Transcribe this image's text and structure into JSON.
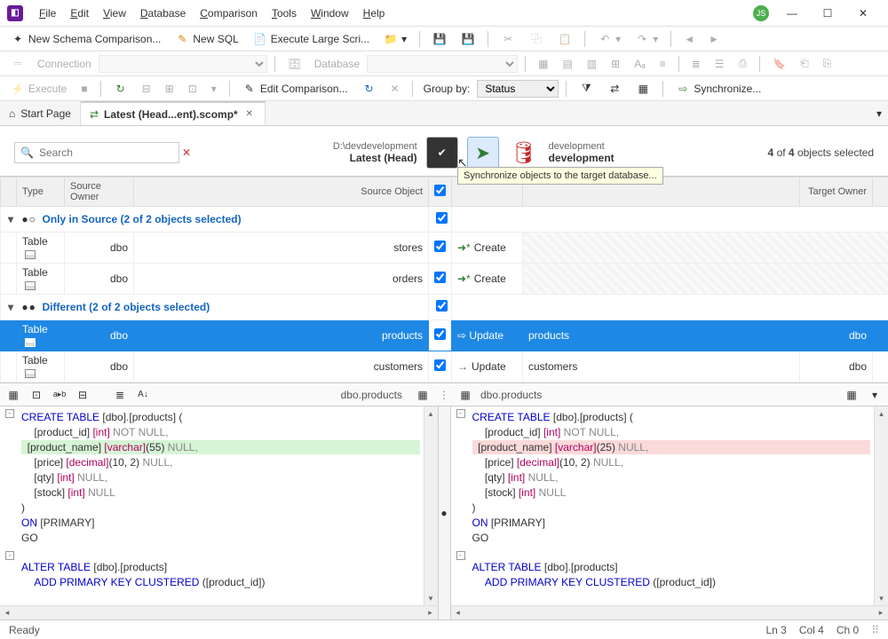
{
  "menu": [
    "File",
    "Edit",
    "View",
    "Database",
    "Comparison",
    "Tools",
    "Window",
    "Help"
  ],
  "user_initials": "JS",
  "toolbar1": {
    "new_comparison": "New Schema Comparison...",
    "new_sql": "New SQL",
    "exec_large": "Execute Large Scri..."
  },
  "toolbar2": {
    "connection_label": "Connection",
    "database_label": "Database"
  },
  "toolbar3": {
    "execute": "Execute",
    "edit_comparison": "Edit Comparison...",
    "group_by_label": "Group by:",
    "group_by_value": "Status",
    "synchronize": "Synchronize..."
  },
  "tabs": {
    "start": "Start Page",
    "active": "Latest (Head...ent).scomp*"
  },
  "header": {
    "search_placeholder": "Search",
    "source_path": "D:\\devdevelopment",
    "source_name": "Latest (Head)",
    "target_path": "development",
    "target_name": "development",
    "selection_text_a": "4",
    "selection_text_b": " of ",
    "selection_text_c": "4",
    "selection_text_d": " objects selected",
    "tooltip": "Synchronize objects to the target database..."
  },
  "columns": {
    "type": "Type",
    "source_owner": "Source Owner",
    "source_object": "Source Object",
    "target_owner": "Target Owner"
  },
  "groups": {
    "only_source": "Only in Source (2 of 2 objects selected)",
    "different": "Different (2 of 2 objects selected)"
  },
  "rows": {
    "r1": {
      "type": "Table",
      "owner": "dbo",
      "obj": "stores",
      "action": "Create"
    },
    "r2": {
      "type": "Table",
      "owner": "dbo",
      "obj": "orders",
      "action": "Create"
    },
    "r3": {
      "type": "Table",
      "owner": "dbo",
      "obj": "products",
      "action": "Update",
      "tobj": "products",
      "towner": "dbo"
    },
    "r4": {
      "type": "Table",
      "owner": "dbo",
      "obj": "customers",
      "action": "Update",
      "tobj": "customers",
      "towner": "dbo"
    }
  },
  "diff": {
    "left_name": "dbo.products",
    "right_name": "dbo.products",
    "left": {
      "l1a": "CREATE TABLE ",
      "l1b": "[dbo].[products] (",
      "l2a": "[product_id]",
      "l2b": " [int]",
      "l2c": " NOT NULL,",
      "l3a": "[product_name]",
      "l3b": " [varchar]",
      "l3c": "(",
      "l3d": "55",
      "l3e": ")",
      "l3f": " NULL,",
      "l4a": "[price]",
      "l4b": " [decimal]",
      "l4c": "(10, 2)",
      "l4d": " NULL,",
      "l5a": "[qty]",
      "l5b": " [int]",
      "l5c": " NULL,",
      "l6a": "[stock]",
      "l6b": " [int]",
      "l6c": " NULL",
      "l7": ")",
      "l8": "ON ",
      "l8b": "[PRIMARY]",
      "l9": "GO",
      "l11": "ALTER TABLE ",
      "l11b": "[dbo].[products]",
      "l12": "ADD PRIMARY KEY CLUSTERED ",
      "l12b": "([product_id])"
    },
    "right": {
      "l3d": "25"
    }
  },
  "status": {
    "ready": "Ready",
    "ln": "Ln 3",
    "col": "Col 4",
    "ch": "Ch 0"
  }
}
